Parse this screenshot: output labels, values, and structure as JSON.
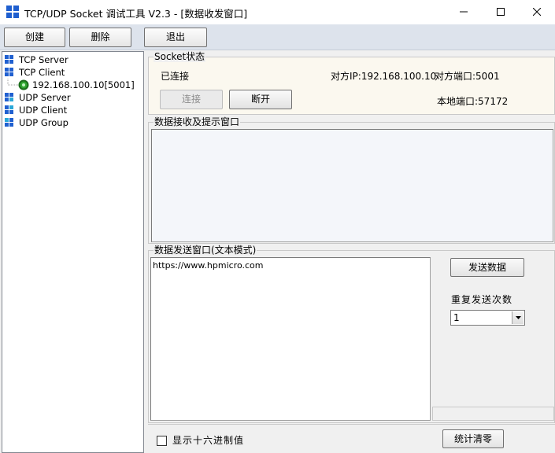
{
  "window": {
    "title": "TCP/UDP Socket 调试工具 V2.3 - [数据收发窗口]",
    "controls": [
      "minimize-icon",
      "maximize-icon",
      "close-icon"
    ]
  },
  "toolbar": {
    "create_label": "创建",
    "delete_label": "删除",
    "exit_label": "退出"
  },
  "tree": {
    "items": [
      {
        "label": "TCP Server",
        "icon": "network-icon"
      },
      {
        "label": "TCP Client",
        "icon": "network-icon"
      },
      {
        "label": "192.168.100.10[5001]",
        "icon": "connected-status-icon"
      },
      {
        "label": "UDP Server",
        "icon": "network-icon"
      },
      {
        "label": "UDP Client",
        "icon": "network-icon"
      },
      {
        "label": "UDP Group",
        "icon": "network-icon"
      }
    ]
  },
  "socket_status": {
    "group_title": "Socket状态",
    "state": "已连接",
    "remote_ip": "对方IP:192.168.100.10",
    "remote_port": "对方端口:5001",
    "local_port": "本地端口:57172",
    "connect_label": "连接",
    "disconnect_label": "断开"
  },
  "receive": {
    "group_title": "数据接收及提示窗口",
    "content": ""
  },
  "send": {
    "group_title": "数据发送窗口(文本模式)",
    "content": "https://www.hpmicro.com",
    "send_label": "发送数据",
    "repeat_label": "重复发送次数",
    "repeat_value": "1"
  },
  "footer": {
    "hex_label": "显示十六进制值",
    "hex_checked": false,
    "clear_stats_label": "统计清零"
  },
  "colors": {
    "toolbar_bg": "#dde3ec",
    "status_panel_bg": "#fbf8ef",
    "status_icon": "#2fa52f"
  }
}
